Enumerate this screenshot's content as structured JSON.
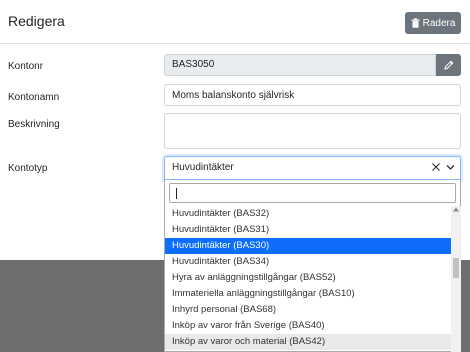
{
  "modal": {
    "title": "Redigera",
    "delete_label": "Radera"
  },
  "form": {
    "kontonr": {
      "label": "Kontonr",
      "value": "BAS3050"
    },
    "kontonamn": {
      "label": "Kontonamn",
      "value": "Moms balanskonto självrisk"
    },
    "beskrivning": {
      "label": "Beskrivning",
      "value": ""
    },
    "kontotyp": {
      "label": "Kontotyp",
      "value": "Huvudintäkter"
    }
  },
  "dropdown": {
    "search_value": "",
    "options": [
      "Huvudintäkter (BAS32)",
      "Huvudintäkter (BAS31)",
      "Huvudintäkter (BAS30)",
      "Huvudintäkter (BAS34)",
      "Hyra av anläggningstillgångar (BAS52)",
      "Immateriella anläggningstillgångar (BAS10)",
      "Inhyrd personal (BAS68)",
      "Inköp av varor från Sverige (BAS40)",
      "Inköp av varor och material (BAS42)"
    ],
    "selected_option": "Huvudintäkter (BAS30)",
    "hovered_option": "Inköp av varor och material (BAS42)"
  },
  "icons": {
    "delete": "trash-icon",
    "edit": "pencil-icon",
    "clear": "close-icon",
    "open": "chevron-down-icon"
  },
  "colors": {
    "selected": "#0d6efd",
    "button_secondary": "#6c757d"
  }
}
